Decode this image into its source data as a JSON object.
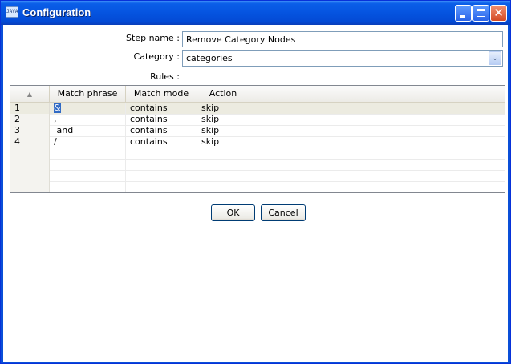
{
  "window": {
    "title": "Configuration",
    "icon": "java-app-icon",
    "icon_text": "JAVA",
    "controls": [
      "minimize-icon",
      "maximize-icon",
      "close-icon"
    ],
    "close_glyph": "✕"
  },
  "form": {
    "step_name_label": "Step name :",
    "step_name_value": "Remove Category Nodes",
    "category_label": "Category :",
    "category_value": "categories",
    "category_arrow": "⌄",
    "rules_label": "Rules :"
  },
  "table": {
    "headers": {
      "index": "▲",
      "match_phrase": "Match phrase",
      "match_mode": "Match mode",
      "action": "Action"
    },
    "rows": [
      {
        "index": "1",
        "phrase": "&",
        "mode": "contains",
        "action": "skip"
      },
      {
        "index": "2",
        "phrase": ",",
        "mode": "contains",
        "action": "skip"
      },
      {
        "index": "3",
        "phrase": " and",
        "mode": "contains",
        "action": "skip"
      },
      {
        "index": "4",
        "phrase": "/",
        "mode": "contains",
        "action": "skip"
      }
    ]
  },
  "buttons": {
    "ok": "OK",
    "cancel": "Cancel"
  }
}
